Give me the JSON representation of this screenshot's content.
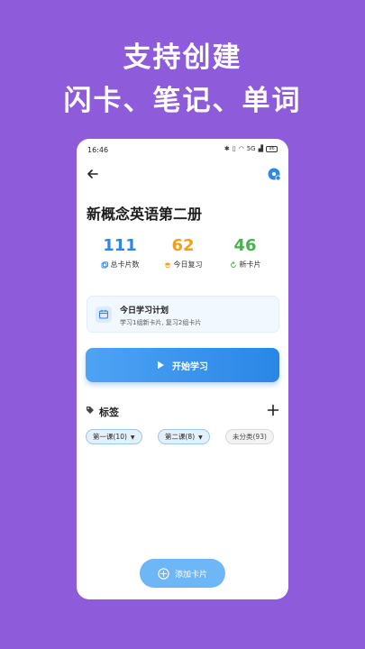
{
  "promo": {
    "line1": "支持创建",
    "line2": "闪卡、笔记、单词"
  },
  "statusbar": {
    "time": "16:46",
    "signal_text": "5G",
    "battery": "96"
  },
  "header": {
    "title": "新概念英语第二册"
  },
  "stats": {
    "total": {
      "value": "111",
      "label": "总卡片数"
    },
    "review": {
      "value": "62",
      "label": "今日复习"
    },
    "new": {
      "value": "46",
      "label": "新卡片"
    }
  },
  "plan": {
    "title": "今日学习计划",
    "desc": "学习1组新卡片, 复习2组卡片"
  },
  "actions": {
    "start_label": "开始学习",
    "add_card_label": "添加卡片"
  },
  "tags": {
    "title": "标签",
    "items": [
      {
        "label": "第一课(10)"
      },
      {
        "label": "第二课(8)"
      },
      {
        "label": "未分类(93)"
      }
    ]
  },
  "colors": {
    "background": "#8E5BDB",
    "primary": "#2E86E8",
    "review": "#F2A019",
    "new": "#4CAF50"
  }
}
